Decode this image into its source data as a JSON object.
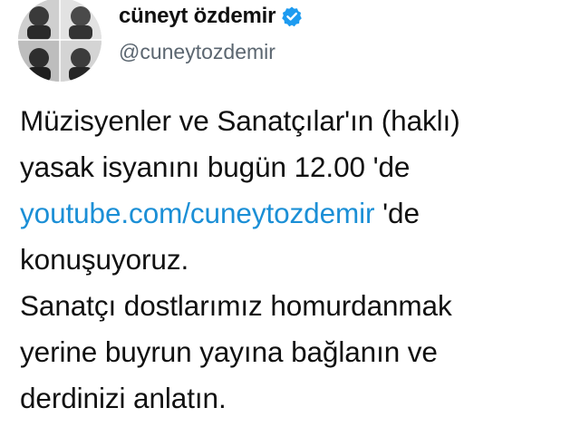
{
  "author": {
    "display_name": "cüneyt özdemir",
    "handle": "@cuneytozdemir",
    "verified_icon": "verified-badge-icon",
    "avatar_icon": "profile-collage-avatar"
  },
  "tweet": {
    "line1": "Müzisyenler ve Sanatçılar'ın (haklı)",
    "line2": "yasak isyanını bugün 12.00 'de",
    "link": "youtube.com/cuneytozdemir",
    "line3_suffix": " 'de",
    "line4": "konuşuyoruz.",
    "line5": "Sanatçı dostlarımız homurdanmak",
    "line6": "yerine buyrun yayına bağlanın ve",
    "line7": "derdinizi anlatın."
  },
  "colors": {
    "link": "#1b8fd6",
    "verified": "#1d9bf0",
    "handle": "#5b6670",
    "text": "#111111"
  }
}
